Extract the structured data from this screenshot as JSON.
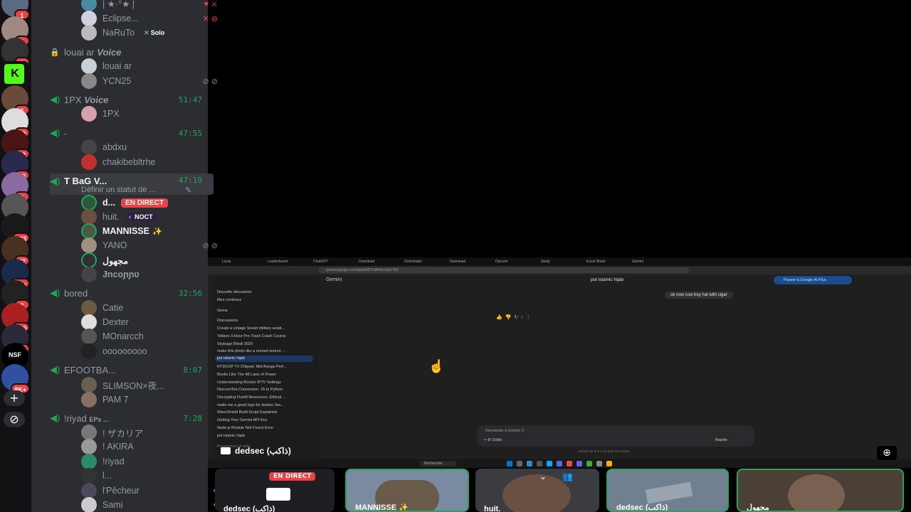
{
  "servers": [
    {
      "badge": "1"
    },
    {
      "badge": "1"
    },
    {
      "badge": "2"
    },
    {
      "label": "K"
    },
    {
      "badge": "6"
    },
    {
      "badge": "70"
    },
    {
      "badge": "32"
    },
    {
      "badge": "18"
    },
    {
      "badge": "3"
    },
    {
      "badge": ""
    },
    {
      "badge": "163"
    },
    {
      "badge": "47"
    },
    {
      "badge": "1K+"
    },
    {
      "badge": "3"
    },
    {
      "badge": "150"
    },
    {
      "badge": "16"
    },
    {
      "label": "NSF"
    },
    {
      "badge": "8K+"
    }
  ],
  "rail_actions": {
    "add": "+",
    "discover": "⊘"
  },
  "channels": {
    "top_users": [
      {
        "name": "| ★·°★ |"
      },
      {
        "name": "Eclipse..."
      },
      {
        "name": "NaRuTo",
        "tag": "Solo"
      }
    ],
    "louai": {
      "name": "louai ar",
      "suffix": "Voice",
      "users": [
        "louai ar",
        "YCN25"
      ]
    },
    "onepx": {
      "name": "1PX",
      "suffix": "Voice",
      "time": "51:47",
      "users": [
        "1PX"
      ]
    },
    "dash": {
      "name": "-",
      "time": "47:55",
      "users": [
        "abdxu",
        "chakibebltrhe"
      ]
    },
    "tbag": {
      "name": "T BaG V...",
      "time": "47:19",
      "status": "Définir un statut de ...",
      "users": [
        {
          "name": "d...",
          "live": "EN DIRECT"
        },
        {
          "name": "huit.",
          "tag": "NOCT"
        },
        {
          "name": "MANNISSE",
          "extra": "✨"
        },
        {
          "name": "YANO"
        },
        {
          "name": "مجهول"
        },
        {
          "name": "Ɉncoɲɲʋ"
        }
      ]
    },
    "bored": {
      "name": "bored",
      "time": "32:56",
      "users": [
        "Catie",
        "Dexter",
        "MOnarcch",
        "ooooooooo"
      ]
    },
    "efoot": {
      "name": "EFOOTBA...",
      "time": "8:07",
      "users": [
        "SLIMSON×夜...",
        "PAM 7"
      ]
    },
    "riyad": {
      "name": "!riyad",
      "suffix": "EPs ...",
      "time": "7:28",
      "users": [
        "! ザカリア",
        "! AKIRA",
        "!riyad",
        "l...",
        "l'Pêcheur",
        "Sami"
      ]
    }
  },
  "screen": {
    "tabs": [
      "Louai",
      "Leaderboard",
      "ChatGPT",
      "Download",
      "Downloads",
      "Download",
      "Discord",
      "Study",
      "Excel Sheet",
      "Gemini"
    ],
    "url": "gemini.google.com/app/d9071d8f46c3a3175d",
    "title": "Gemini",
    "chat_title": "put islamic hijab",
    "upgrade": "Passer à Google AI Plus",
    "sidebar": [
      "Nouvelle discussion",
      "Mes contenus",
      "Gems",
      "Discussions",
      "Create a vintage Soviet military aviati...",
      "Tekken 3-Hour Pro-Track Crash Course",
      "Skybage Bleali 2020",
      "make this photo like a nomad texture ...",
      "put islamic hijab",
      "RT3015P TV Chipset: Mid-Range Perf...",
      "Books Like The 48 Laws of Power",
      "Understanding Rocker IPTV Settings",
      "Discord Bot Conversion: JS to Python",
      "Decrypting FiveM Resources: Ethical ...",
      "make me a good logo for dedsec fea...",
      "WaveShield Build Script Explained",
      "Getting Your Gemini API Key",
      "Node.js Module Not Found Error",
      "put islamic hijab",
      "Paramètres et aide"
    ],
    "user_msg": "ok now cow boy hat with cigar",
    "input_placeholder": "Demander à Gemini 3",
    "tools": "Outils",
    "mode": "Rapide",
    "disclaimer": "Gemini est une IA et peut se tromper",
    "search": "Rechercher",
    "sharer": "dedsec (ذاكب)"
  },
  "tiles": [
    {
      "name": "dedsec (ذاكب)",
      "live": "EN DIRECT"
    },
    {
      "name": "MANNISSE ✨"
    },
    {
      "name": "huit."
    },
    {
      "name": "dedsec (ذاكب)"
    },
    {
      "name": "مجهول"
    }
  ]
}
